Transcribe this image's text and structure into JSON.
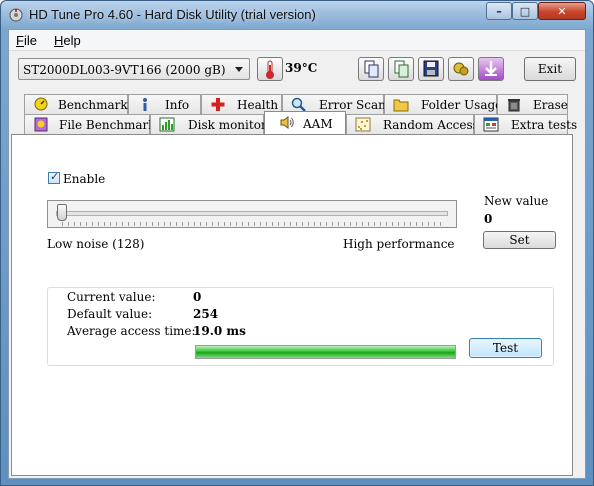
{
  "window": {
    "title": "HD Tune Pro 4.60 - Hard Disk Utility (trial version)"
  },
  "menu": {
    "file": "File",
    "help": "Help",
    "file_key": "F",
    "help_key": "H"
  },
  "toolbar": {
    "drive": "ST2000DL003-9VT166 (2000 gB)",
    "temperature": "39°C",
    "exit_label": "Exit"
  },
  "tabs_row1": [
    {
      "label": "Benchmark",
      "icon": "benchmark-icon"
    },
    {
      "label": "Info",
      "icon": "info-icon"
    },
    {
      "label": "Health",
      "icon": "health-icon"
    },
    {
      "label": "Error Scan",
      "icon": "error-scan-icon"
    },
    {
      "label": "Folder Usage",
      "icon": "folder-icon"
    },
    {
      "label": "Erase",
      "icon": "erase-icon"
    }
  ],
  "tabs_row2": [
    {
      "label": "File Benchmark",
      "icon": "file-benchmark-icon"
    },
    {
      "label": "Disk monitor",
      "icon": "disk-monitor-icon"
    },
    {
      "label": "AAM",
      "icon": "speaker-icon",
      "active": true
    },
    {
      "label": "Random Access",
      "icon": "random-access-icon"
    },
    {
      "label": "Extra tests",
      "icon": "extra-tests-icon"
    }
  ],
  "aam": {
    "enable_label": "Enable",
    "enable_checked": true,
    "slider_value": 0,
    "low_label": "Low noise (128)",
    "high_label": "High performance",
    "new_value_label": "New value",
    "new_value": "0",
    "set_label": "Set",
    "current_label": "Current value:",
    "current_value": "0",
    "default_label": "Default value:",
    "default_value": "254",
    "avg_label": "Average access time:",
    "avg_value": "19.0 ms",
    "progress_percent": 100,
    "test_label": "Test"
  },
  "colors": {
    "accent": "#3c7fb1",
    "progress": "#37c437",
    "close": "#c8442b"
  }
}
